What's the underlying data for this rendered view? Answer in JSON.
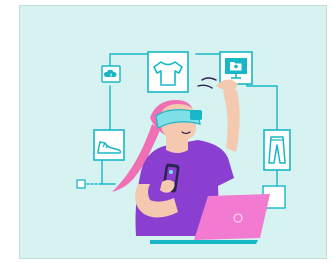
{
  "illustration": {
    "icons": [
      "cloud-upload-icon",
      "tshirt-icon",
      "monitor-folder-icon",
      "shoe-icon",
      "pants-icon",
      "checkbox-icon",
      "smartphone-icon",
      "laptop-icon",
      "vr-headset-icon"
    ],
    "colors": {
      "background": "#d6f2f1",
      "line": "#18b7c7",
      "shirt": "#8a3fd1",
      "hair": "#f06fb5",
      "skin": "#f4c9b0",
      "laptop": "#f27ad0",
      "headset": "#7fe0e8"
    }
  }
}
